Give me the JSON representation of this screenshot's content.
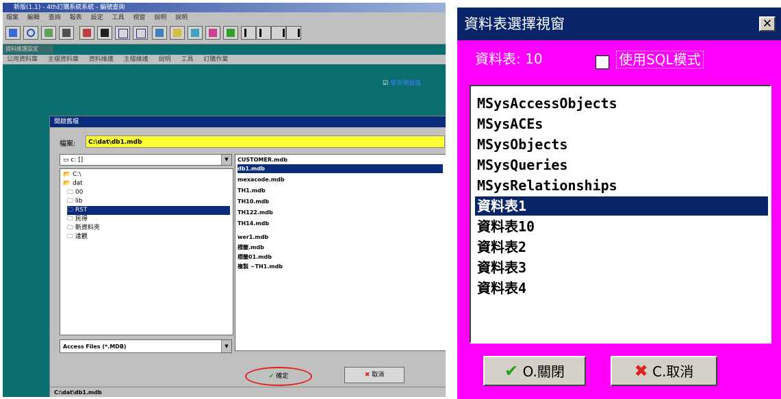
{
  "left_app": {
    "title": "新版(1.1) - 4th訂購系統系統 - 編號查詢",
    "menu": [
      "檔案",
      "編輯",
      "查詢",
      "報表",
      "設定",
      "工具",
      "視窗",
      "說明",
      "說明"
    ],
    "subpanel_title": "資料維護設定",
    "submenu": [
      "公用資料庫",
      "主檔資料庫",
      "資料維護",
      "主檔維護",
      "說明",
      "工具",
      "訂購作業"
    ],
    "corner_checkbox_label": "使用預設值"
  },
  "open_dialog": {
    "title": "開啟舊檔",
    "filename_label": "檔案:",
    "filename_value": "C:\\dat\\db1.mdb",
    "drive_value": "c: []",
    "directories": [
      "C:\\",
      "dat",
      "00",
      "lib",
      "RST",
      "民得",
      "新資料夾",
      "達觀"
    ],
    "selected_directory_index": 4,
    "files": [
      "CUSTOMER.mdb",
      "db1.mdb",
      "mexacode.mdb",
      "TH1.mdb",
      "TH10.mdb",
      "TH122.mdb",
      "TH14.mdb",
      "wer1.mdb",
      "標籤.mdb",
      "標籤01.mdb",
      "複製 ~TH1.mdb"
    ],
    "selected_file_index": 1,
    "filetype_value": "Access  Files (*.MDB)",
    "ok_label": "確定",
    "cancel_label": "取消",
    "status_path": "C:\\dat\\db1.mdb"
  },
  "table_window": {
    "title": "資料表選擇視窗",
    "close_symbol": "✕",
    "count_label": "資料表: 10",
    "sql_checkbox_label": "使用SQL模式",
    "tables": [
      "MSysAccessObjects",
      "MSysACEs",
      "MSysObjects",
      "MSysQueries",
      "MSysRelationships",
      "資料表1",
      "資料表10",
      "資料表2",
      "資料表3",
      "資料表4"
    ],
    "selected_table_index": 5,
    "close_button_label": "O.關閉",
    "cancel_button_label": "C.取消",
    "accent_color": "#ff00ff",
    "title_color": "#0a246a"
  }
}
